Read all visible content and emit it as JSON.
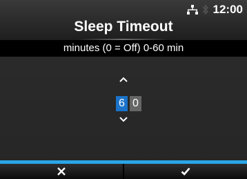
{
  "status_bar": {
    "clock": "12:00",
    "icons": [
      "network-icon",
      "bluetooth-icon"
    ]
  },
  "header": {
    "title": "Sleep Timeout"
  },
  "subtitle": "minutes (0 = Off) 0-60 min",
  "spinner": {
    "digits": [
      "6",
      "0"
    ],
    "selected_index": 0,
    "up_icon": "chevron-up-icon",
    "down_icon": "chevron-down-icon"
  },
  "buttons": [
    {
      "icon": "close-icon",
      "action": "cancel"
    },
    {
      "icon": "check-icon",
      "action": "confirm"
    }
  ],
  "colors": {
    "accent": "#2aa7e8",
    "selected_digit": "#1a73c9",
    "unselected_digit": "#666666"
  }
}
